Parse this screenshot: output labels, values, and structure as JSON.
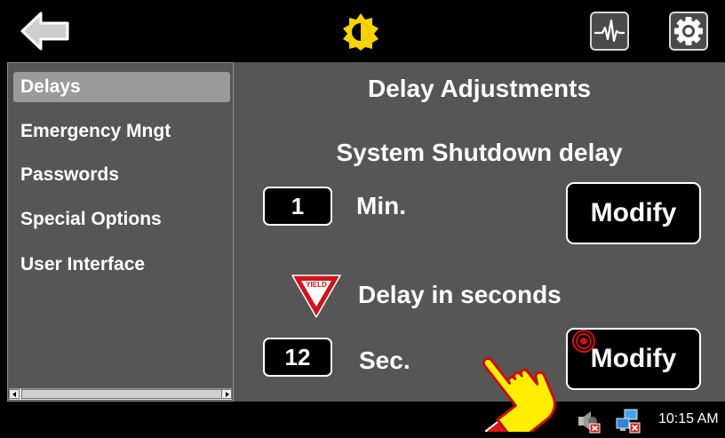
{
  "topbar": {
    "back_icon": "back-arrow-icon",
    "brightness_icon": "brightness-icon",
    "pulse_icon": "pulse-icon",
    "settings_icon": "gear-icon"
  },
  "sidebar": {
    "items": [
      {
        "label": "Delays",
        "selected": true
      },
      {
        "label": "Emergency Mngt",
        "selected": false
      },
      {
        "label": "Passwords",
        "selected": false
      },
      {
        "label": "Special Options",
        "selected": false
      },
      {
        "label": "User Interface",
        "selected": false
      }
    ]
  },
  "main": {
    "title": "Delay Adjustments",
    "shutdown": {
      "heading": "System Shutdown delay",
      "value": "1",
      "unit": "Min.",
      "button": "Modify"
    },
    "seconds": {
      "heading": "Delay in seconds",
      "yield_text": "YIELD",
      "value": "12",
      "unit": "Sec.",
      "button": "Modify"
    }
  },
  "taskbar": {
    "clock": "10:15 AM",
    "sound_icon": "speaker-muted-icon",
    "network_icon": "network-disconnected-icon"
  },
  "colors": {
    "panel_bg": "#565656",
    "selected_bg": "#9a9a9a",
    "brightness": "#f5d400",
    "yield_red": "#d0141c",
    "hand_yellow": "#ffee00",
    "hand_outline": "#d01010"
  }
}
